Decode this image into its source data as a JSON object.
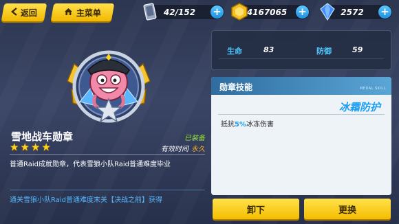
{
  "topbar": {
    "back_label": "返回",
    "home_label": "主菜单",
    "resources": [
      {
        "name": "stamina",
        "icon": "phone-stamina-icon",
        "value": "42/152"
      },
      {
        "name": "gold",
        "icon": "gold-coin-icon",
        "value": "4167065"
      },
      {
        "name": "crystal",
        "icon": "crystal-gem-icon",
        "value": "2572"
      }
    ]
  },
  "medal": {
    "name": "雪地战车勋章",
    "stars": 4,
    "status": "已装备",
    "validity_label": "有效时间",
    "validity_value": "永久",
    "description": "普通Raid成就勋章，代表雪狼小队Raid普通难度毕业",
    "obtain": "通关雪狼小队Raid普通难度末关【决战之前】获得"
  },
  "stats": {
    "hp_label": "生命",
    "hp_value": "83",
    "def_label": "防御",
    "def_value": "59"
  },
  "skill": {
    "header": "勋章技能",
    "header_sub": "MEDAL SKILL",
    "name": "冰霜防护",
    "desc_prefix": "抵抗",
    "desc_highlight": "5%",
    "desc_suffix": "冰冻伤害"
  },
  "actions": {
    "unequip_label": "卸下",
    "replace_label": "更换"
  },
  "colors": {
    "accent_yellow": "#f5bd00",
    "accent_blue": "#1e9ef0",
    "equipped_green": "#9be33a",
    "permanent_orange": "#ffb020"
  }
}
